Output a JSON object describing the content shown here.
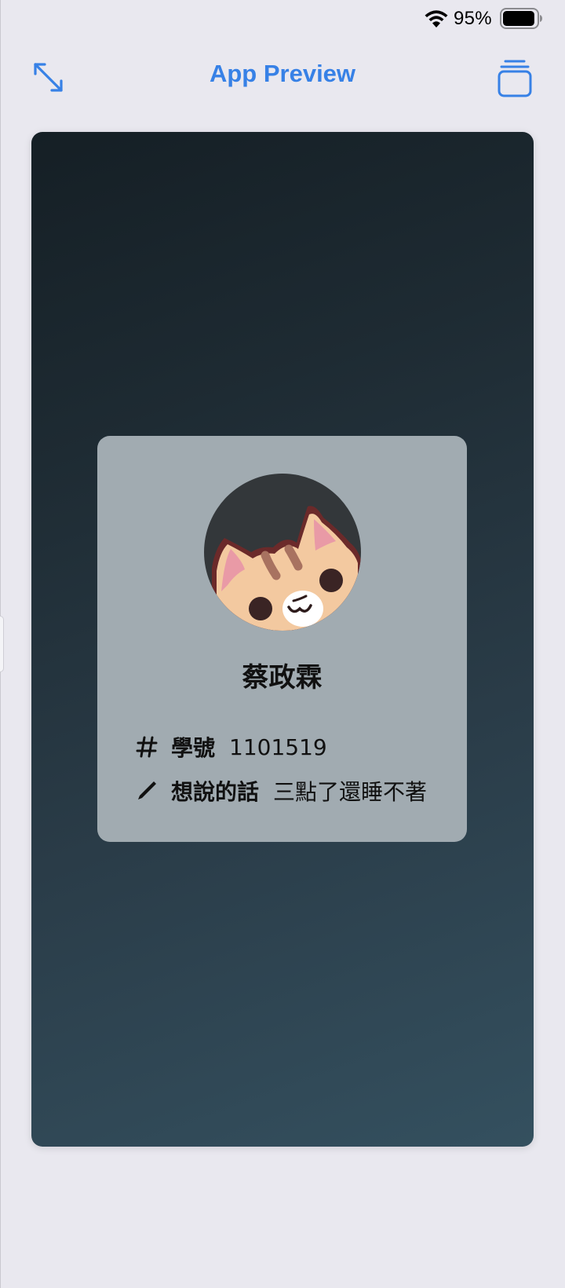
{
  "status_bar": {
    "battery_percent": "95%",
    "battery_level": 0.95,
    "icons": [
      "wifi-icon",
      "battery-icon"
    ]
  },
  "nav": {
    "title": "App Preview",
    "left_icon": "expand-arrows-icon",
    "right_icon": "window-stack-icon"
  },
  "colors": {
    "accent": "#3781e6",
    "page_background": "#e9e8ef",
    "card_background": "#a1abb1",
    "preview_gradient_start": "#151f25",
    "preview_gradient_end": "#34505f"
  },
  "profile": {
    "avatar": "cat-avatar",
    "name": "蔡政霖",
    "fields": [
      {
        "icon": "hash-icon",
        "label": "學號",
        "value": "1101519"
      },
      {
        "icon": "pencil-icon",
        "label": "想說的話",
        "value": "三點了還睡不著"
      }
    ]
  }
}
